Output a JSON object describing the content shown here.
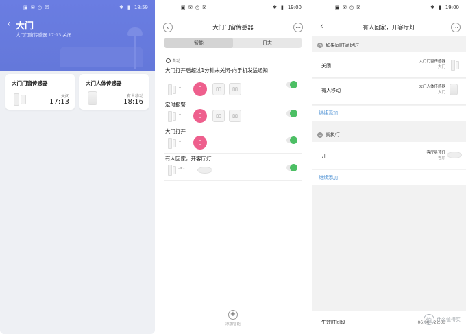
{
  "status_bar": {
    "p1_time": "18:59",
    "p2_time": "19:00",
    "p3_time": "19:00",
    "left_icons": "▣ ✉ ◷ ☒"
  },
  "screen1": {
    "title": "大门",
    "subtitle": "大门门窗传感器 17:13 关闭",
    "cards": [
      {
        "name": "大门门窗传感器",
        "status": "关闭",
        "time": "17:13"
      },
      {
        "name": "大门人体传感器",
        "status": "有人移动",
        "time": "18:16"
      }
    ]
  },
  "screen2": {
    "title": "大门门窗传感器",
    "tabs": [
      "智能",
      "日志"
    ],
    "auto_label": "自动",
    "rules": [
      {
        "title": "大门打开后超过1分钟未关闭-向手机发送通知"
      },
      {
        "title": "定时报警"
      },
      {
        "title": "大门打开"
      },
      {
        "title": "有人回家，开客厅灯"
      }
    ],
    "add_label": "添加智能"
  },
  "screen3": {
    "title": "有人回家，开客厅灯",
    "condition_header": "如果同时满足时",
    "conditions": [
      {
        "label": "关闭",
        "device": "大门门窗传感器",
        "room": "大门"
      },
      {
        "label": "有人移动",
        "device": "大门人体传感器",
        "room": "大门"
      }
    ],
    "continue_add": "继续添加",
    "action_header": "就执行",
    "actions": [
      {
        "label": "开",
        "device": "客厅吸顶灯",
        "room": "客厅"
      }
    ],
    "continue_add2": "继续添加",
    "effective_label": "生效时间段",
    "effective_value": "06:00 - 22:00"
  },
  "watermark": "什么值得买"
}
